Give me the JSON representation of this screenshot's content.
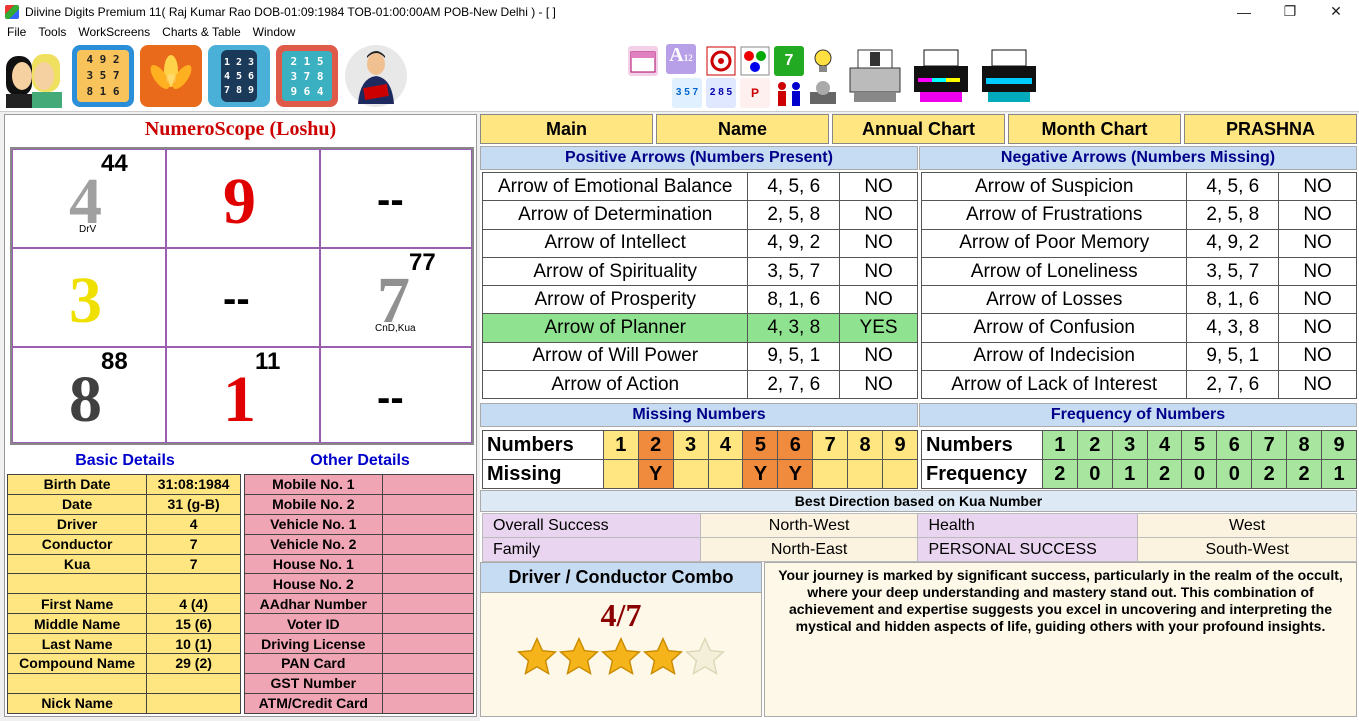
{
  "window": {
    "title": "Diivine Digits Premium 11( Raj Kumar Rao DOB-01:09:1984 TOB-01:00:00AM POB-New Delhi ) - [ ]",
    "minimize": "—",
    "maximize": "❐",
    "close": "✕"
  },
  "menu": [
    "File",
    "Tools",
    "WorkScreens",
    "Charts & Table",
    "Window"
  ],
  "toolbar": {
    "tile_numbers_1": [
      "4 9 2",
      "3 5 7",
      "8 1 6"
    ],
    "tile_numbers_2": [
      "1 2 3",
      "4 5 6",
      "7 8 9"
    ],
    "tile_numbers_3": [
      "2 1 5",
      "3 7 8",
      "9 6 4"
    ],
    "icons": [
      "people-icon",
      "lo-shu-grid-icon",
      "lotus-icon",
      "phone-keypad-icon",
      "number-square-icon",
      "businessman-icon",
      "calendar-icon",
      "letters-numbers-icon",
      "target-icon",
      "dots-icon",
      "number-7-icon",
      "bulb-icon",
      "numbers-icon",
      "chart-icon",
      "pencil-icon",
      "palette-icon",
      "family-icon",
      "gear-icon",
      "printer-1-icon",
      "printer-2-icon",
      "printer-3-icon"
    ],
    "small_glyphs": {
      "letters": "A",
      "letters_num": "12",
      "digit7": "7",
      "nums": "3 5 7",
      "nums2": "2 8 5",
      "label": "P"
    }
  },
  "left": {
    "title": "NumeroScope (Loshu)",
    "grid": {
      "c1": {
        "digit": "4",
        "sup": "44",
        "tag": "DrV"
      },
      "c2": {
        "digit": "9"
      },
      "c3": {
        "dash": "--"
      },
      "c4": {
        "digit": "3"
      },
      "c5": {
        "dash": "--"
      },
      "c6": {
        "digit": "7",
        "sup": "77",
        "tag": "CnD,Kua"
      },
      "c7": {
        "digit": "8",
        "sup": "88"
      },
      "c8": {
        "digit": "1",
        "sup": "11"
      },
      "c9": {
        "dash": "--"
      }
    },
    "basic_title": "Basic Details",
    "other_title": "Other Details",
    "basic": [
      [
        "Birth Date",
        "31:08:1984"
      ],
      [
        "Date",
        "31 (g-B)"
      ],
      [
        "Driver",
        "4"
      ],
      [
        "Conductor",
        "7"
      ],
      [
        "Kua",
        "7"
      ],
      [
        "",
        ""
      ],
      [
        "First Name",
        "4  (4)"
      ],
      [
        "Middle Name",
        "15  (6)"
      ],
      [
        "Last Name",
        "10  (1)"
      ],
      [
        "Compound Name",
        "29  (2)"
      ],
      [
        "",
        ""
      ],
      [
        "Nick Name",
        ""
      ]
    ],
    "other": [
      [
        "Mobile No. 1",
        ""
      ],
      [
        "Mobile No. 2",
        ""
      ],
      [
        "Vehicle No. 1",
        ""
      ],
      [
        "Vehicle No. 2",
        ""
      ],
      [
        "House No. 1",
        ""
      ],
      [
        "House No. 2",
        ""
      ],
      [
        "AAdhar Number",
        ""
      ],
      [
        "Voter ID",
        ""
      ],
      [
        "Driving License",
        ""
      ],
      [
        "PAN Card",
        ""
      ],
      [
        "GST Number",
        ""
      ],
      [
        "ATM/Credit Card",
        ""
      ]
    ]
  },
  "tabs": [
    "Main",
    "Name",
    "Annual Chart",
    "Month Chart",
    "PRASHNA"
  ],
  "positive": {
    "title": "Positive Arrows (Numbers Present)",
    "rows": [
      [
        "Arrow of Emotional Balance",
        "4, 5, 6",
        "NO"
      ],
      [
        "Arrow of Determination",
        "2, 5, 8",
        "NO"
      ],
      [
        "Arrow of Intellect",
        "4, 9, 2",
        "NO"
      ],
      [
        "Arrow of Spirituality",
        "3, 5, 7",
        "NO"
      ],
      [
        "Arrow of Prosperity",
        "8, 1, 6",
        "NO"
      ],
      [
        "Arrow of Planner",
        "4, 3, 8",
        "YES"
      ],
      [
        "Arrow of Will Power",
        "9, 5, 1",
        "NO"
      ],
      [
        "Arrow of Action",
        "2, 7, 6",
        "NO"
      ]
    ]
  },
  "negative": {
    "title": "Negative Arrows (Numbers Missing)",
    "rows": [
      [
        "Arrow of Suspicion",
        "4, 5, 6",
        "NO"
      ],
      [
        "Arrow of Frustrations",
        "2, 5, 8",
        "NO"
      ],
      [
        "Arrow of Poor Memory",
        "4, 9, 2",
        "NO"
      ],
      [
        "Arrow of Loneliness",
        "3, 5, 7",
        "NO"
      ],
      [
        "Arrow of Losses",
        "8, 1, 6",
        "NO"
      ],
      [
        "Arrow of Confusion",
        "4, 3, 8",
        "NO"
      ],
      [
        "Arrow of Indecision",
        "9, 5, 1",
        "NO"
      ],
      [
        "Arrow of Lack of Interest",
        "2, 7, 6",
        "NO"
      ]
    ]
  },
  "missing": {
    "title": "Missing Numbers",
    "row1_label": "Numbers",
    "row2_label": "Missing",
    "numbers": [
      "1",
      "2",
      "3",
      "4",
      "5",
      "6",
      "7",
      "8",
      "9"
    ],
    "missing": [
      "",
      "Y",
      "",
      "",
      "Y",
      "Y",
      "",
      "",
      ""
    ]
  },
  "frequency": {
    "title": "Frequency of Numbers",
    "row1_label": "Numbers",
    "row2_label": "Frequency",
    "numbers": [
      "1",
      "2",
      "3",
      "4",
      "5",
      "6",
      "7",
      "8",
      "9"
    ],
    "freq": [
      "2",
      "0",
      "1",
      "2",
      "0",
      "0",
      "2",
      "2",
      "1"
    ]
  },
  "direction": {
    "title": "Best Direction based on Kua Number",
    "rows": [
      [
        "Overall Success",
        "North-West",
        "Health",
        "West"
      ],
      [
        "Family",
        "North-East",
        "PERSONAL SUCCESS",
        "South-West"
      ]
    ]
  },
  "combo": {
    "title": "Driver / Conductor Combo",
    "ratio": "4/7",
    "stars_filled": 4,
    "stars_total": 5,
    "description": "Your journey is marked by significant success, particularly in the realm of the occult, where your deep understanding and mastery stand out. This combination of achievement and expertise suggests you excel in uncovering and interpreting the mystical and hidden aspects of life, guiding others with your profound insights."
  },
  "colors": {
    "digit_4": "#a0a0a0",
    "digit_9": "#e00000",
    "digit_3": "#f0e000",
    "digit_7": "#909090",
    "digit_8": "#404040",
    "digit_1": "#e00000",
    "highlight_green": "#8fe28f",
    "missing_orange": "#f08a3c",
    "freq_green": "#a8e6a0"
  }
}
